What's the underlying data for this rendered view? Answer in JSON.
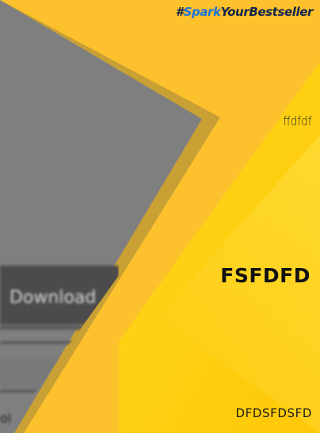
{
  "hashtag": {
    "prefix": "#",
    "part1": "Spark",
    "part2": "YourBestseller"
  },
  "text_small": "ffdfdf",
  "text_main": "FSFDFD",
  "text_bottom": "DFDSFDSFD",
  "screenshot": {
    "button_label": "Download",
    "bottom_char": "ol"
  },
  "colors": {
    "background": "#FCC12D",
    "accent_yellow": "#FFD000",
    "panel_grey": "#7F7F7F",
    "border_gold": "#C9A034",
    "hashtag_blue": "#1A73D9",
    "hashtag_dark": "#12264A"
  }
}
